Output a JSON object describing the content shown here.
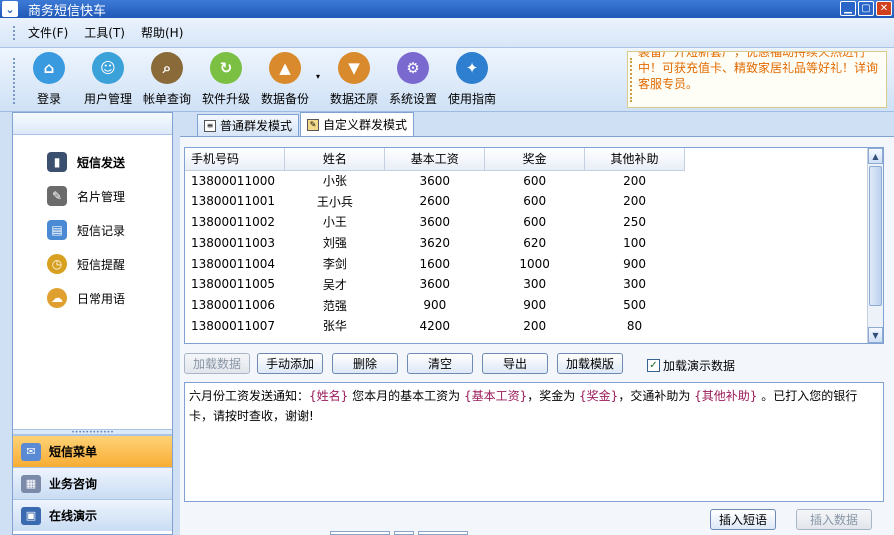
{
  "window": {
    "title": "商务短信快车",
    "app_icon": "chevron-down-icon",
    "controls": [
      "minimize-icon",
      "maximize-icon",
      "close-icon"
    ]
  },
  "menu": [
    {
      "label": "文件(F)"
    },
    {
      "label": "工具(T)"
    },
    {
      "label": "帮助(H)"
    }
  ],
  "toolbar": [
    {
      "label": "登录",
      "icon": "login-globe-icon",
      "color": "#3a9ae0"
    },
    {
      "label": "用户管理",
      "icon": "users-icon",
      "color": "#3aa1d9"
    },
    {
      "label": "帐单查询",
      "icon": "magnifier-icon",
      "color": "#8b6a3a"
    },
    {
      "label": "软件升级",
      "icon": "upgrade-icon",
      "color": "#7bc043"
    },
    {
      "label": "数据备份",
      "icon": "backup-box-icon",
      "color": "#d88a2c"
    },
    {
      "label": "数据还原",
      "icon": "restore-box-icon",
      "color": "#d88a2c"
    },
    {
      "label": "系统设置",
      "icon": "settings-icon",
      "color": "#7a6ad0"
    },
    {
      "label": "使用指南",
      "icon": "compass-icon",
      "color": "#2f7fd0"
    }
  ],
  "ad": {
    "text": "装备广开短新套厂，优惠福动持续火热进行中！可获充值卡、精致家居礼品等好礼！详询客服专员。"
  },
  "sidebar": {
    "items": [
      {
        "label": "短信发送",
        "icon": "mobile-phone-icon",
        "color": "#3b4f6e",
        "active": true
      },
      {
        "label": "名片管理",
        "icon": "pen-card-icon",
        "color": "#6b6b6b",
        "active": false
      },
      {
        "label": "短信记录",
        "icon": "record-icon",
        "color": "#4a8ad4",
        "active": false
      },
      {
        "label": "短信提醒",
        "icon": "clock-icon",
        "color": "#d8a020",
        "active": false
      },
      {
        "label": "日常用语",
        "icon": "chat-bubbles-icon",
        "color": "#e0a030",
        "active": false
      }
    ],
    "sections": [
      {
        "label": "短信菜单",
        "icon": "envelope-icon",
        "color": "#5a8ad4",
        "active": true
      },
      {
        "label": "业务咨询",
        "icon": "grid-icon",
        "color": "#7a8aa8",
        "active": false
      },
      {
        "label": "在线演示",
        "icon": "presentation-icon",
        "color": "#3a6ab0",
        "active": false
      }
    ]
  },
  "tabs": [
    {
      "label": "普通群发模式",
      "icon": "document-icon",
      "active": false
    },
    {
      "label": "自定义群发模式",
      "icon": "folder-edit-icon",
      "active": true
    }
  ],
  "grid": {
    "headers": [
      "手机号码",
      "姓名",
      "基本工资",
      "奖金",
      "其他补助"
    ],
    "rows": [
      [
        "13800011000",
        "小张",
        "3600",
        "600",
        "200"
      ],
      [
        "13800011001",
        "王小兵",
        "2600",
        "600",
        "200"
      ],
      [
        "13800011002",
        "小王",
        "3600",
        "600",
        "250"
      ],
      [
        "13800011003",
        "刘强",
        "3620",
        "620",
        "100"
      ],
      [
        "13800011004",
        "李剑",
        "1600",
        "1000",
        "900"
      ],
      [
        "13800011005",
        "吴才",
        "3600",
        "300",
        "300"
      ],
      [
        "13800011006",
        "范强",
        "900",
        "900",
        "500"
      ],
      [
        "13800011007",
        "张华",
        "4200",
        "200",
        "80"
      ]
    ]
  },
  "actions": {
    "load_data": "加载数据",
    "manual_add": "手动添加",
    "delete": "删除",
    "clear": "清空",
    "export": "导出",
    "load_template": "加载模版",
    "demo_checkbox_label": "加载演示数据",
    "demo_checked": true
  },
  "message": {
    "part1": "六月份工资发送通知：",
    "ph_name": "{姓名}",
    "part2": " 您本月的基本工资为 ",
    "ph_salary": "{基本工资}",
    "part3": "，奖金为 ",
    "ph_bonus": "{奖金}",
    "part4": "，交通补助为 ",
    "ph_allowance": "{其他补助}",
    "part5": " 。已打入您的银行卡，请按时查收，谢谢!"
  },
  "bottom": {
    "insert_phrase": "插入短语",
    "insert_data": "插入数据"
  }
}
